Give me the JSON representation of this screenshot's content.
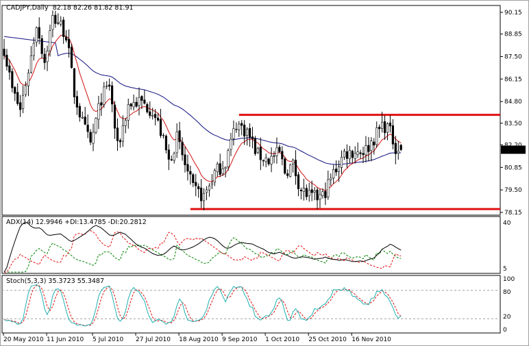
{
  "header": {
    "symbol_label": "CADJPY,Daily",
    "ohlc": "82.18 82.26 81.82 81.91"
  },
  "price_axis": {
    "ticks": [
      "90.15",
      "88.85",
      "87.50",
      "86.15",
      "84.80",
      "83.50",
      "82.20",
      "80.85",
      "79.50",
      "78.15"
    ],
    "current_price": "81.91",
    "min": 78.15,
    "max": 90.15
  },
  "adx_panel": {
    "label": "ADX(14) 12.9946 +DI:13.4785 -DI:20.2812",
    "ticks": [
      "40",
      "5"
    ],
    "min": 5,
    "max": 40
  },
  "stoch_panel": {
    "label": "Stoch(5,3,3) 35.3723 55.3487",
    "ticks": [
      "100",
      "80",
      "20",
      "0"
    ],
    "levels": [
      80,
      20
    ]
  },
  "date_axis": {
    "labels": [
      "20 May 2010",
      "11 Jun 2010",
      "5 Jul 2010",
      "27 Jul 2010",
      "18 Aug 2010",
      "9 Sep 2010",
      "1 Oct 2010",
      "25 Oct 2010",
      "16 Nov 2010"
    ],
    "label_bars": [
      0,
      16,
      33,
      49,
      65,
      81,
      97,
      113,
      129
    ]
  },
  "chart_data": {
    "type": "candlestick",
    "bars": 148,
    "close_keypoints": [
      [
        0,
        88.0
      ],
      [
        3,
        85.5
      ],
      [
        6,
        84.3
      ],
      [
        10,
        87.5
      ],
      [
        12,
        89.5
      ],
      [
        15,
        87.2
      ],
      [
        18,
        89.8
      ],
      [
        20,
        89.6
      ],
      [
        23,
        88.8
      ],
      [
        26,
        85.3
      ],
      [
        29,
        83.5
      ],
      [
        32,
        82.2
      ],
      [
        36,
        85.0
      ],
      [
        39,
        85.8
      ],
      [
        42,
        82.0
      ],
      [
        46,
        84.6
      ],
      [
        50,
        84.8
      ],
      [
        55,
        84.3
      ],
      [
        58,
        83.0
      ],
      [
        61,
        81.2
      ],
      [
        64,
        82.6
      ],
      [
        67,
        81.0
      ],
      [
        70,
        79.5
      ],
      [
        74,
        79.1
      ],
      [
        78,
        80.5
      ],
      [
        82,
        81.2
      ],
      [
        86,
        83.5
      ],
      [
        90,
        83.0
      ],
      [
        94,
        81.6
      ],
      [
        98,
        81.3
      ],
      [
        102,
        81.7
      ],
      [
        104,
        80.6
      ],
      [
        107,
        81.0
      ],
      [
        110,
        79.5
      ],
      [
        114,
        79.0
      ],
      [
        118,
        79.1
      ],
      [
        122,
        80.5
      ],
      [
        126,
        81.7
      ],
      [
        130,
        81.8
      ],
      [
        134,
        81.9
      ],
      [
        137,
        82.6
      ],
      [
        140,
        83.4
      ],
      [
        142,
        83.3
      ],
      [
        145,
        82.1
      ],
      [
        147,
        81.91
      ]
    ],
    "horizontal_lines": [
      {
        "price": 84.0,
        "from_bar": 87,
        "color": "#e01010"
      },
      {
        "price": 78.35,
        "from_bar": 69,
        "color": "#e01010"
      }
    ],
    "fast_ma_period": 10,
    "slow_ma_period": 100,
    "colors": {
      "fast_ma": "#d01010",
      "slow_ma": "#101080",
      "adx": "#000000",
      "plus_di": "#008000",
      "minus_di": "#e01010",
      "stoch_main": "#20b0b0",
      "stoch_signal": "#e01010"
    }
  }
}
